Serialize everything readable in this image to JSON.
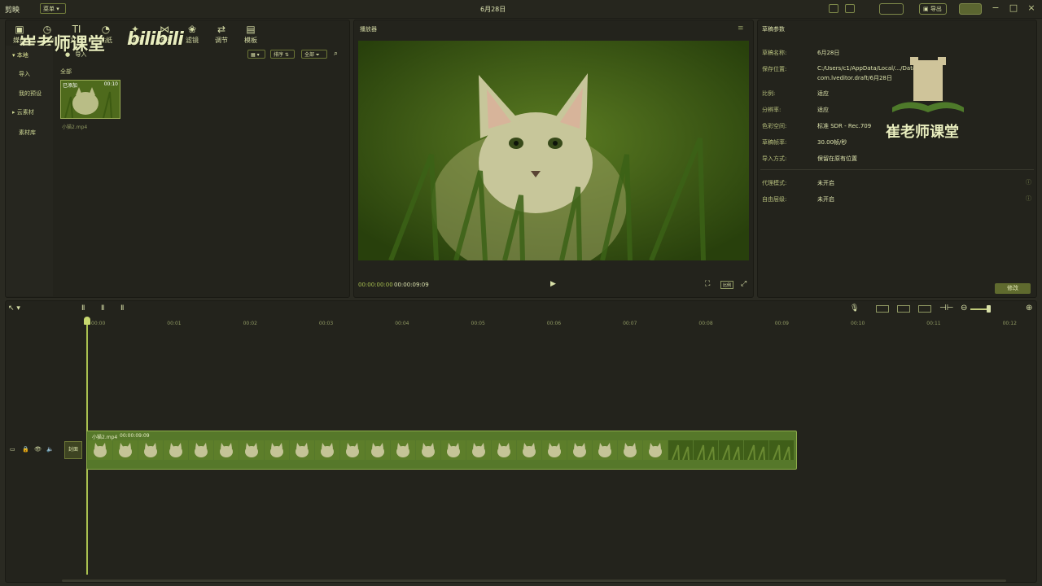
{
  "app": {
    "name": "剪映",
    "menu": "菜单",
    "title": "6月28日"
  },
  "titlebar_buttons": {
    "pro": "",
    "export": "导出"
  },
  "toolbar": [
    {
      "label": "媒体",
      "icon": "media-icon"
    },
    {
      "label": "音频",
      "icon": "audio-icon"
    },
    {
      "label": "文本",
      "icon": "text-icon"
    },
    {
      "label": "贴纸",
      "icon": "sticker-icon"
    },
    {
      "label": "特效",
      "icon": "effects-icon"
    },
    {
      "label": "转场",
      "icon": "transition-icon"
    },
    {
      "label": "滤镜",
      "icon": "filter-icon"
    },
    {
      "label": "调节",
      "icon": "adjust-icon"
    },
    {
      "label": "模板",
      "icon": "template-icon"
    }
  ],
  "watermark": {
    "text": "崔老师课堂",
    "bili": "bilibili"
  },
  "media": {
    "sidebar": [
      "本地",
      "导入",
      "我的预设",
      "云素材",
      "素材库"
    ],
    "import_label": "导入",
    "section_all": "全部",
    "sort_label": "排序",
    "filter_label": "全部",
    "clip": {
      "badge": "已添加",
      "duration": "00:10",
      "name": "小猫2.mp4"
    }
  },
  "player": {
    "title": "播放器",
    "current": "00:00:00:00",
    "total": "00:00:09:09",
    "ratio_label": "比例"
  },
  "draft": {
    "title": "草稿参数",
    "params": [
      {
        "label": "草稿名称:",
        "value": "6月28日"
      },
      {
        "label": "保存位置:",
        "value": "C:/Users/c1/AppData/Local/.../Data/Projects/"
      },
      {
        "label": "",
        "value": "com.lveditor.draft/6月28日"
      },
      {
        "label": "比例:",
        "value": "适应"
      },
      {
        "label": "分辨率:",
        "value": "适应"
      },
      {
        "label": "色彩空间:",
        "value": "标准 SDR - Rec.709"
      },
      {
        "label": "草稿帧率:",
        "value": "30.00帧/秒"
      },
      {
        "label": "导入方式:",
        "value": "保留在原有位置"
      },
      {
        "label": "代理模式:",
        "value": "未开启"
      },
      {
        "label": "自由层级:",
        "value": "未开启"
      }
    ],
    "modify_button": "修改",
    "watermark_text": "崔老师课堂"
  },
  "timeline": {
    "ruler": [
      "00:00",
      "00:01",
      "00:02",
      "00:03",
      "00:04",
      "00:05",
      "00:06",
      "00:07",
      "00:08",
      "00:09",
      "00:10",
      "00:11",
      "00:12"
    ],
    "clip_name": "小猫2.mp4",
    "clip_duration": "00:00:09:09",
    "cover_label": "封面"
  },
  "colors": {
    "accent": "#7f8f3a",
    "bg": "#2a2a22",
    "panel": "#23231c",
    "text": "#d8e0a8"
  }
}
